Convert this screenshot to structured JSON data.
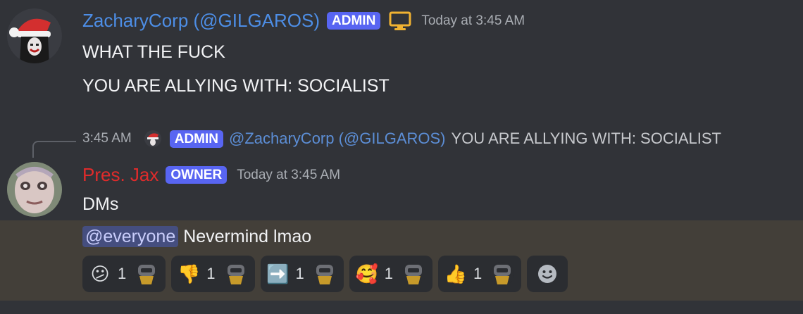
{
  "message1": {
    "username": "ZacharyCorp (@GILGAROS)",
    "username_color": "#4d8ee6",
    "role_badge": "ADMIN",
    "device_icon": "desktop-icon",
    "timestamp": "Today at 3:45 AM",
    "lines": [
      "WHAT THE FUCK",
      "YOU ARE ALLYING WITH: SOCIALIST"
    ]
  },
  "reply": {
    "time": "3:45 AM",
    "role_badge": "ADMIN",
    "replied_user": "@ZacharyCorp (@GILGAROS)",
    "replied_text": "YOU ARE ALLYING WITH: SOCIALIST"
  },
  "message2": {
    "username": "Pres. Jax",
    "username_color": "#e02b2b",
    "role_badge": "OWNER",
    "timestamp": "Today at 3:45 AM",
    "line1": "DMs",
    "mention": "@everyone",
    "line2_text": "Nevermind lmao"
  },
  "reactions": [
    {
      "emoji": "😕",
      "icon": "confused-face-icon",
      "count": "1"
    },
    {
      "emoji": "👎",
      "icon": "thumbs-down-icon",
      "count": "1"
    },
    {
      "emoji": "➡️",
      "icon": "right-arrow-icon",
      "count": "1"
    },
    {
      "emoji": "🥰",
      "icon": "smiling-face-with-hearts-icon",
      "count": "1"
    },
    {
      "emoji": "👍",
      "icon": "thumbs-up-icon",
      "count": "1"
    }
  ],
  "colors": {
    "background": "#313338",
    "highlight": "#433f39",
    "badge": "#5865f2",
    "mention_bg": "#454e7f"
  }
}
